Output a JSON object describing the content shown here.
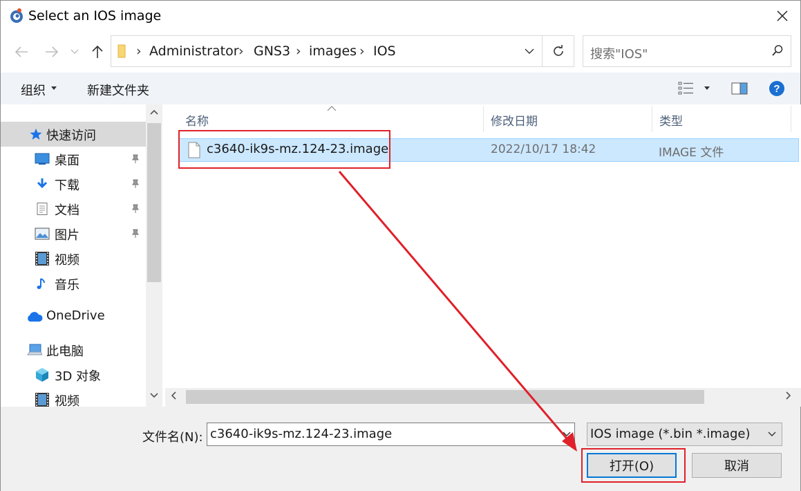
{
  "window": {
    "title": "Select an IOS image"
  },
  "address": {
    "breadcrumb": [
      "Administrator",
      "GNS3",
      "images",
      "IOS"
    ],
    "separator": "›"
  },
  "search": {
    "placeholder": "搜索\"IOS\""
  },
  "toolbar": {
    "organize_label": "组织",
    "new_folder_label": "新建文件夹"
  },
  "nav": {
    "quick_access": "快速访问",
    "items": [
      {
        "label": "桌面",
        "icon": "desktop-icon",
        "pinned": true
      },
      {
        "label": "下载",
        "icon": "download-icon",
        "pinned": true
      },
      {
        "label": "文档",
        "icon": "document-icon",
        "pinned": true
      },
      {
        "label": "图片",
        "icon": "picture-icon",
        "pinned": true
      },
      {
        "label": "视频",
        "icon": "video-icon",
        "pinned": false
      },
      {
        "label": "音乐",
        "icon": "music-icon",
        "pinned": false
      }
    ],
    "onedrive": "OneDrive",
    "this_pc": "此电脑",
    "pc_items": [
      {
        "label": "3D 对象",
        "icon": "3d-objects-icon"
      },
      {
        "label": "视频",
        "icon": "video-icon"
      }
    ]
  },
  "files": {
    "columns": {
      "name": "名称",
      "modified": "修改日期",
      "type": "类型"
    },
    "rows": [
      {
        "name": "c3640-ik9s-mz.124-23.image",
        "modified": "2022/10/17 18:42",
        "type": "IMAGE 文件",
        "selected": true
      }
    ]
  },
  "bottom": {
    "filename_label": "文件名(N):",
    "filename_value": "c3640-ik9s-mz.124-23.image",
    "filter_value": "IOS image (*.bin *.image)",
    "open_label": "打开(O)",
    "cancel_label": "取消"
  },
  "colors": {
    "selection": "#cce8ff",
    "annotation": "#e0202a",
    "accent": "#0078d7"
  }
}
